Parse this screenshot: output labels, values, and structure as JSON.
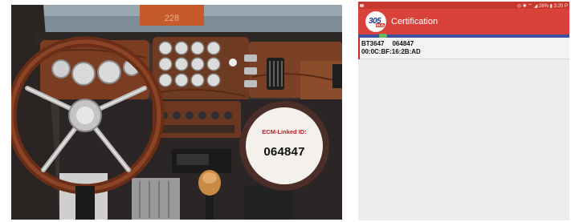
{
  "photo": {
    "ecm_label": "ECM-Linked ID:",
    "ecm_id": "064847",
    "top_plate": "228"
  },
  "phone": {
    "status_right": "◎ ✱ ⌔ ◢ 26% ▮ 3:20 P",
    "app_title": "Certification",
    "logo_number": "305",
    "logo_tag": "ELD",
    "device": {
      "name": "BT3647",
      "id": "064847",
      "mac": "00:0C:BF:16:2B:AD"
    }
  },
  "colors": {
    "app_bar": "#d9423a",
    "accent_strip": "#3d52a0",
    "ecm_label": "#b8202a"
  }
}
